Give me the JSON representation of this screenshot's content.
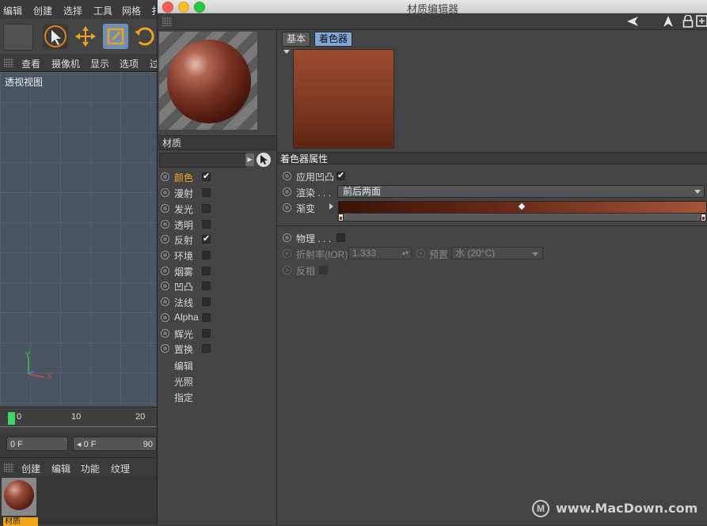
{
  "c4d": {
    "menu": [
      "编辑",
      "创建",
      "选择",
      "工具",
      "网格",
      "扌"
    ],
    "view_menu": [
      "查看",
      "摄像机",
      "显示",
      "选项",
      "过"
    ],
    "viewport_label": "透视视图",
    "axis": {
      "y": "Y",
      "x": "X"
    },
    "timeline": {
      "ticks": [
        "0",
        "10",
        "20"
      ]
    },
    "frame_start": "0 F",
    "frame_current": "0 F",
    "frame_end": "90",
    "material_menu": [
      "创建",
      "编辑",
      "功能",
      "纹理"
    ],
    "material_thumb_label": "材质"
  },
  "window": {
    "title": "材质编辑器",
    "accent": "#f5a623"
  },
  "left": {
    "material_name": "材质",
    "channels": [
      {
        "label": "颜色",
        "checked": true,
        "active": true
      },
      {
        "label": "漫射",
        "checked": false
      },
      {
        "label": "发光",
        "checked": false
      },
      {
        "label": "透明",
        "checked": false
      },
      {
        "label": "反射",
        "checked": true
      },
      {
        "label": "环境",
        "checked": false
      },
      {
        "label": "烟雾",
        "checked": false
      },
      {
        "label": "凹凸",
        "checked": false
      },
      {
        "label": "法线",
        "checked": false
      },
      {
        "label": "Alpha",
        "checked": false
      },
      {
        "label": "辉光",
        "checked": false
      },
      {
        "label": "置换",
        "checked": false
      }
    ],
    "extras": [
      "编辑",
      "光照",
      "指定"
    ]
  },
  "right": {
    "tabs": [
      "基本",
      "着色器"
    ],
    "section": "着色器属性",
    "apply_bump": "应用凹凸",
    "render_label": "渲染",
    "render_dots": ". . .",
    "render_value": "前后两面",
    "gradient_label": "渐变",
    "physical_label": "物理",
    "physical_dots": ". . .",
    "ior_label": "折射率(IOR)",
    "ior_value": "1.333",
    "preset_label": "预置",
    "preset_value": "水 (20°C)",
    "invert_label": "反相"
  },
  "watermark": {
    "logo": "M",
    "text": "www.MacDown.com"
  }
}
